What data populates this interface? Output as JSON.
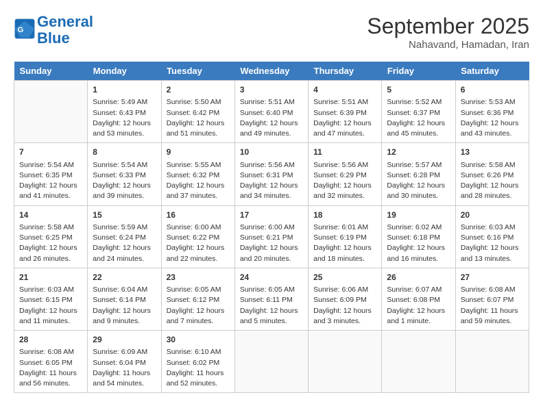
{
  "header": {
    "logo_line1": "General",
    "logo_line2": "Blue",
    "month": "September 2025",
    "location": "Nahavand, Hamadan, Iran"
  },
  "days_of_week": [
    "Sunday",
    "Monday",
    "Tuesday",
    "Wednesday",
    "Thursday",
    "Friday",
    "Saturday"
  ],
  "weeks": [
    [
      {
        "day": "",
        "lines": []
      },
      {
        "day": "1",
        "lines": [
          "Sunrise: 5:49 AM",
          "Sunset: 6:43 PM",
          "Daylight: 12 hours",
          "and 53 minutes."
        ]
      },
      {
        "day": "2",
        "lines": [
          "Sunrise: 5:50 AM",
          "Sunset: 6:42 PM",
          "Daylight: 12 hours",
          "and 51 minutes."
        ]
      },
      {
        "day": "3",
        "lines": [
          "Sunrise: 5:51 AM",
          "Sunset: 6:40 PM",
          "Daylight: 12 hours",
          "and 49 minutes."
        ]
      },
      {
        "day": "4",
        "lines": [
          "Sunrise: 5:51 AM",
          "Sunset: 6:39 PM",
          "Daylight: 12 hours",
          "and 47 minutes."
        ]
      },
      {
        "day": "5",
        "lines": [
          "Sunrise: 5:52 AM",
          "Sunset: 6:37 PM",
          "Daylight: 12 hours",
          "and 45 minutes."
        ]
      },
      {
        "day": "6",
        "lines": [
          "Sunrise: 5:53 AM",
          "Sunset: 6:36 PM",
          "Daylight: 12 hours",
          "and 43 minutes."
        ]
      }
    ],
    [
      {
        "day": "7",
        "lines": [
          "Sunrise: 5:54 AM",
          "Sunset: 6:35 PM",
          "Daylight: 12 hours",
          "and 41 minutes."
        ]
      },
      {
        "day": "8",
        "lines": [
          "Sunrise: 5:54 AM",
          "Sunset: 6:33 PM",
          "Daylight: 12 hours",
          "and 39 minutes."
        ]
      },
      {
        "day": "9",
        "lines": [
          "Sunrise: 5:55 AM",
          "Sunset: 6:32 PM",
          "Daylight: 12 hours",
          "and 37 minutes."
        ]
      },
      {
        "day": "10",
        "lines": [
          "Sunrise: 5:56 AM",
          "Sunset: 6:31 PM",
          "Daylight: 12 hours",
          "and 34 minutes."
        ]
      },
      {
        "day": "11",
        "lines": [
          "Sunrise: 5:56 AM",
          "Sunset: 6:29 PM",
          "Daylight: 12 hours",
          "and 32 minutes."
        ]
      },
      {
        "day": "12",
        "lines": [
          "Sunrise: 5:57 AM",
          "Sunset: 6:28 PM",
          "Daylight: 12 hours",
          "and 30 minutes."
        ]
      },
      {
        "day": "13",
        "lines": [
          "Sunrise: 5:58 AM",
          "Sunset: 6:26 PM",
          "Daylight: 12 hours",
          "and 28 minutes."
        ]
      }
    ],
    [
      {
        "day": "14",
        "lines": [
          "Sunrise: 5:58 AM",
          "Sunset: 6:25 PM",
          "Daylight: 12 hours",
          "and 26 minutes."
        ]
      },
      {
        "day": "15",
        "lines": [
          "Sunrise: 5:59 AM",
          "Sunset: 6:24 PM",
          "Daylight: 12 hours",
          "and 24 minutes."
        ]
      },
      {
        "day": "16",
        "lines": [
          "Sunrise: 6:00 AM",
          "Sunset: 6:22 PM",
          "Daylight: 12 hours",
          "and 22 minutes."
        ]
      },
      {
        "day": "17",
        "lines": [
          "Sunrise: 6:00 AM",
          "Sunset: 6:21 PM",
          "Daylight: 12 hours",
          "and 20 minutes."
        ]
      },
      {
        "day": "18",
        "lines": [
          "Sunrise: 6:01 AM",
          "Sunset: 6:19 PM",
          "Daylight: 12 hours",
          "and 18 minutes."
        ]
      },
      {
        "day": "19",
        "lines": [
          "Sunrise: 6:02 AM",
          "Sunset: 6:18 PM",
          "Daylight: 12 hours",
          "and 16 minutes."
        ]
      },
      {
        "day": "20",
        "lines": [
          "Sunrise: 6:03 AM",
          "Sunset: 6:16 PM",
          "Daylight: 12 hours",
          "and 13 minutes."
        ]
      }
    ],
    [
      {
        "day": "21",
        "lines": [
          "Sunrise: 6:03 AM",
          "Sunset: 6:15 PM",
          "Daylight: 12 hours",
          "and 11 minutes."
        ]
      },
      {
        "day": "22",
        "lines": [
          "Sunrise: 6:04 AM",
          "Sunset: 6:14 PM",
          "Daylight: 12 hours",
          "and 9 minutes."
        ]
      },
      {
        "day": "23",
        "lines": [
          "Sunrise: 6:05 AM",
          "Sunset: 6:12 PM",
          "Daylight: 12 hours",
          "and 7 minutes."
        ]
      },
      {
        "day": "24",
        "lines": [
          "Sunrise: 6:05 AM",
          "Sunset: 6:11 PM",
          "Daylight: 12 hours",
          "and 5 minutes."
        ]
      },
      {
        "day": "25",
        "lines": [
          "Sunrise: 6:06 AM",
          "Sunset: 6:09 PM",
          "Daylight: 12 hours",
          "and 3 minutes."
        ]
      },
      {
        "day": "26",
        "lines": [
          "Sunrise: 6:07 AM",
          "Sunset: 6:08 PM",
          "Daylight: 12 hours",
          "and 1 minute."
        ]
      },
      {
        "day": "27",
        "lines": [
          "Sunrise: 6:08 AM",
          "Sunset: 6:07 PM",
          "Daylight: 11 hours",
          "and 59 minutes."
        ]
      }
    ],
    [
      {
        "day": "28",
        "lines": [
          "Sunrise: 6:08 AM",
          "Sunset: 6:05 PM",
          "Daylight: 11 hours",
          "and 56 minutes."
        ]
      },
      {
        "day": "29",
        "lines": [
          "Sunrise: 6:09 AM",
          "Sunset: 6:04 PM",
          "Daylight: 11 hours",
          "and 54 minutes."
        ]
      },
      {
        "day": "30",
        "lines": [
          "Sunrise: 6:10 AM",
          "Sunset: 6:02 PM",
          "Daylight: 11 hours",
          "and 52 minutes."
        ]
      },
      {
        "day": "",
        "lines": []
      },
      {
        "day": "",
        "lines": []
      },
      {
        "day": "",
        "lines": []
      },
      {
        "day": "",
        "lines": []
      }
    ]
  ]
}
